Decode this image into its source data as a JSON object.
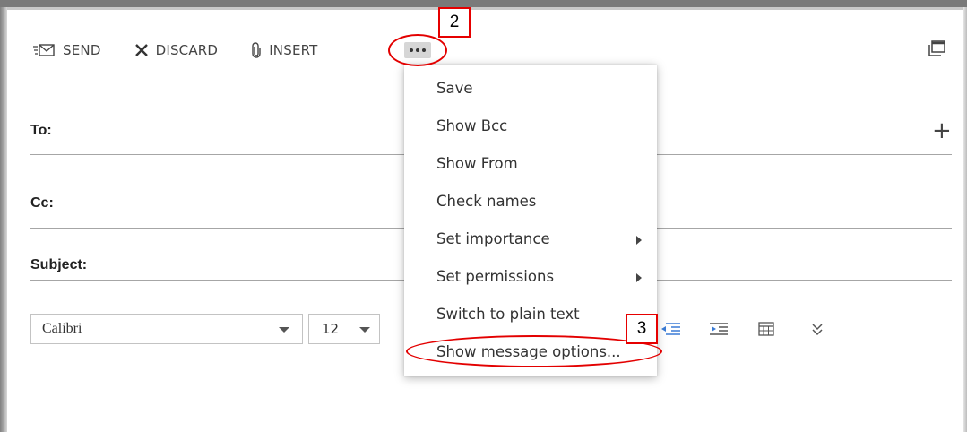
{
  "toolbar": {
    "send_label": "SEND",
    "discard_label": "DISCARD",
    "insert_label": "INSERT",
    "more_icon": "ellipsis-icon",
    "popout_icon": "popout-window-icon"
  },
  "fields": {
    "to_label": "To:",
    "cc_label": "Cc:",
    "subject_label": "Subject:",
    "add_recipient_icon": "plus-icon"
  },
  "formatting": {
    "font_family": "Calibri",
    "font_size": "12",
    "icons": [
      "decrease-indent-icon",
      "increase-indent-icon",
      "insert-table-icon",
      "more-formatting-icon"
    ]
  },
  "menu": {
    "items": [
      {
        "label": "Save"
      },
      {
        "label": "Show Bcc"
      },
      {
        "label": "Show From"
      },
      {
        "label": "Check names"
      },
      {
        "label": "Set importance",
        "submenu": true
      },
      {
        "label": "Set permissions",
        "submenu": true
      },
      {
        "label": "Switch to plain text"
      },
      {
        "label": "Show message options..."
      }
    ]
  },
  "annotations": {
    "step2": "2",
    "step3": "3",
    "highlight_color": "#e30000"
  }
}
